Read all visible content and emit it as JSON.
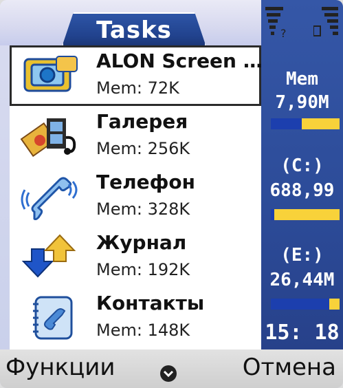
{
  "header": {
    "tab_title": "Tasks"
  },
  "tasks": [
    {
      "name": "ALON Screen …",
      "mem": "Mem: 72K",
      "icon": "camera-app-icon"
    },
    {
      "name": "Галерея",
      "mem": "Mem: 256K",
      "icon": "gallery-icon"
    },
    {
      "name": "Телефон",
      "mem": "Mem: 328K",
      "icon": "phone-icon"
    },
    {
      "name": "Журнал",
      "mem": "Mem: 192K",
      "icon": "log-arrows-icon"
    },
    {
      "name": "Контакты",
      "mem": "Mem: 148K",
      "icon": "contacts-icon"
    }
  ],
  "status_panel": {
    "mem_label": "Mem",
    "mem_value": "7,90M",
    "mem_fill": 0.45,
    "drive_c_label": "(C:)",
    "drive_c_value": "688,99",
    "drive_c_fill": 0.05,
    "drive_e_label": "(E:)",
    "drive_e_value": "26,44M",
    "drive_e_fill": 0.85,
    "clock": "15: 18"
  },
  "softkeys": {
    "left": "Функции",
    "right": "Отмена"
  },
  "colors": {
    "tab_blue": "#21428d",
    "panel_blue": "#2c4b98",
    "bar_yellow": "#f8d23a",
    "bar_blue": "#1c3fae"
  }
}
